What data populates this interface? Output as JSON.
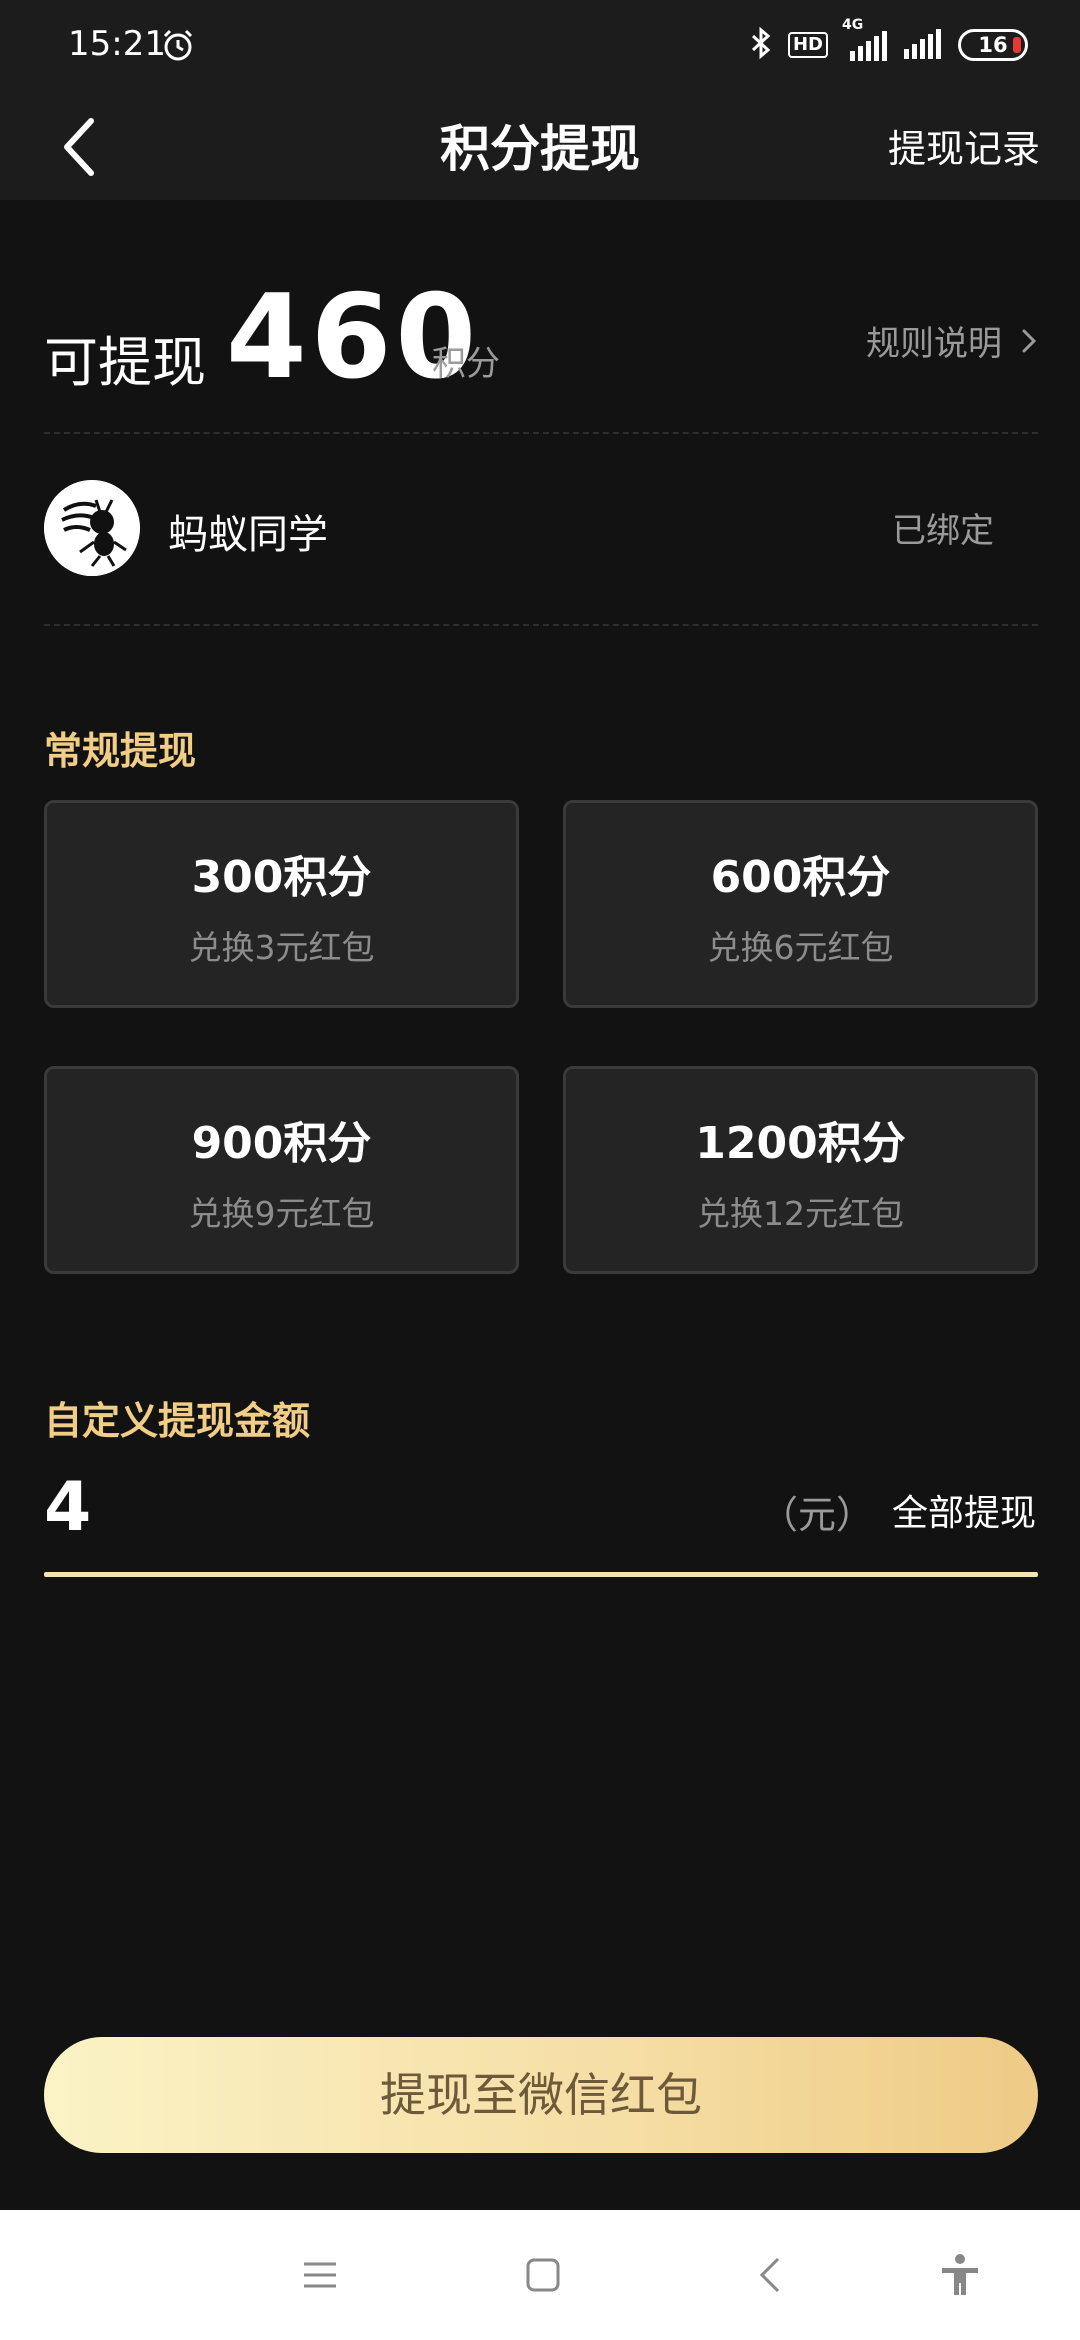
{
  "status_bar": {
    "time": "15:21",
    "hd": "HD",
    "network": "4G",
    "battery": "16"
  },
  "header": {
    "title": "积分提现",
    "records_link": "提现记录"
  },
  "balance": {
    "label": "可提现",
    "value": "460",
    "unit": "积分",
    "rules_link": "规则说明"
  },
  "account": {
    "name": "蚂蚁同学",
    "status": "已绑定"
  },
  "regular": {
    "title": "常规提现",
    "options": [
      {
        "points": "300积分",
        "desc": "兑换3元红包"
      },
      {
        "points": "600积分",
        "desc": "兑换6元红包"
      },
      {
        "points": "900积分",
        "desc": "兑换9元红包"
      },
      {
        "points": "1200积分",
        "desc": "兑换12元红包"
      }
    ]
  },
  "custom": {
    "title": "自定义提现金额",
    "amount": "4",
    "unit": "（元）",
    "withdraw_all": "全部提现"
  },
  "submit_label": "提现至微信红包",
  "colors": {
    "background": "#121212",
    "header": "#1c1c1c",
    "accent_gold": "#f2cd85",
    "card": "#242424",
    "button_gradient_start": "#fbf3c6",
    "button_gradient_end": "#eecb86"
  }
}
